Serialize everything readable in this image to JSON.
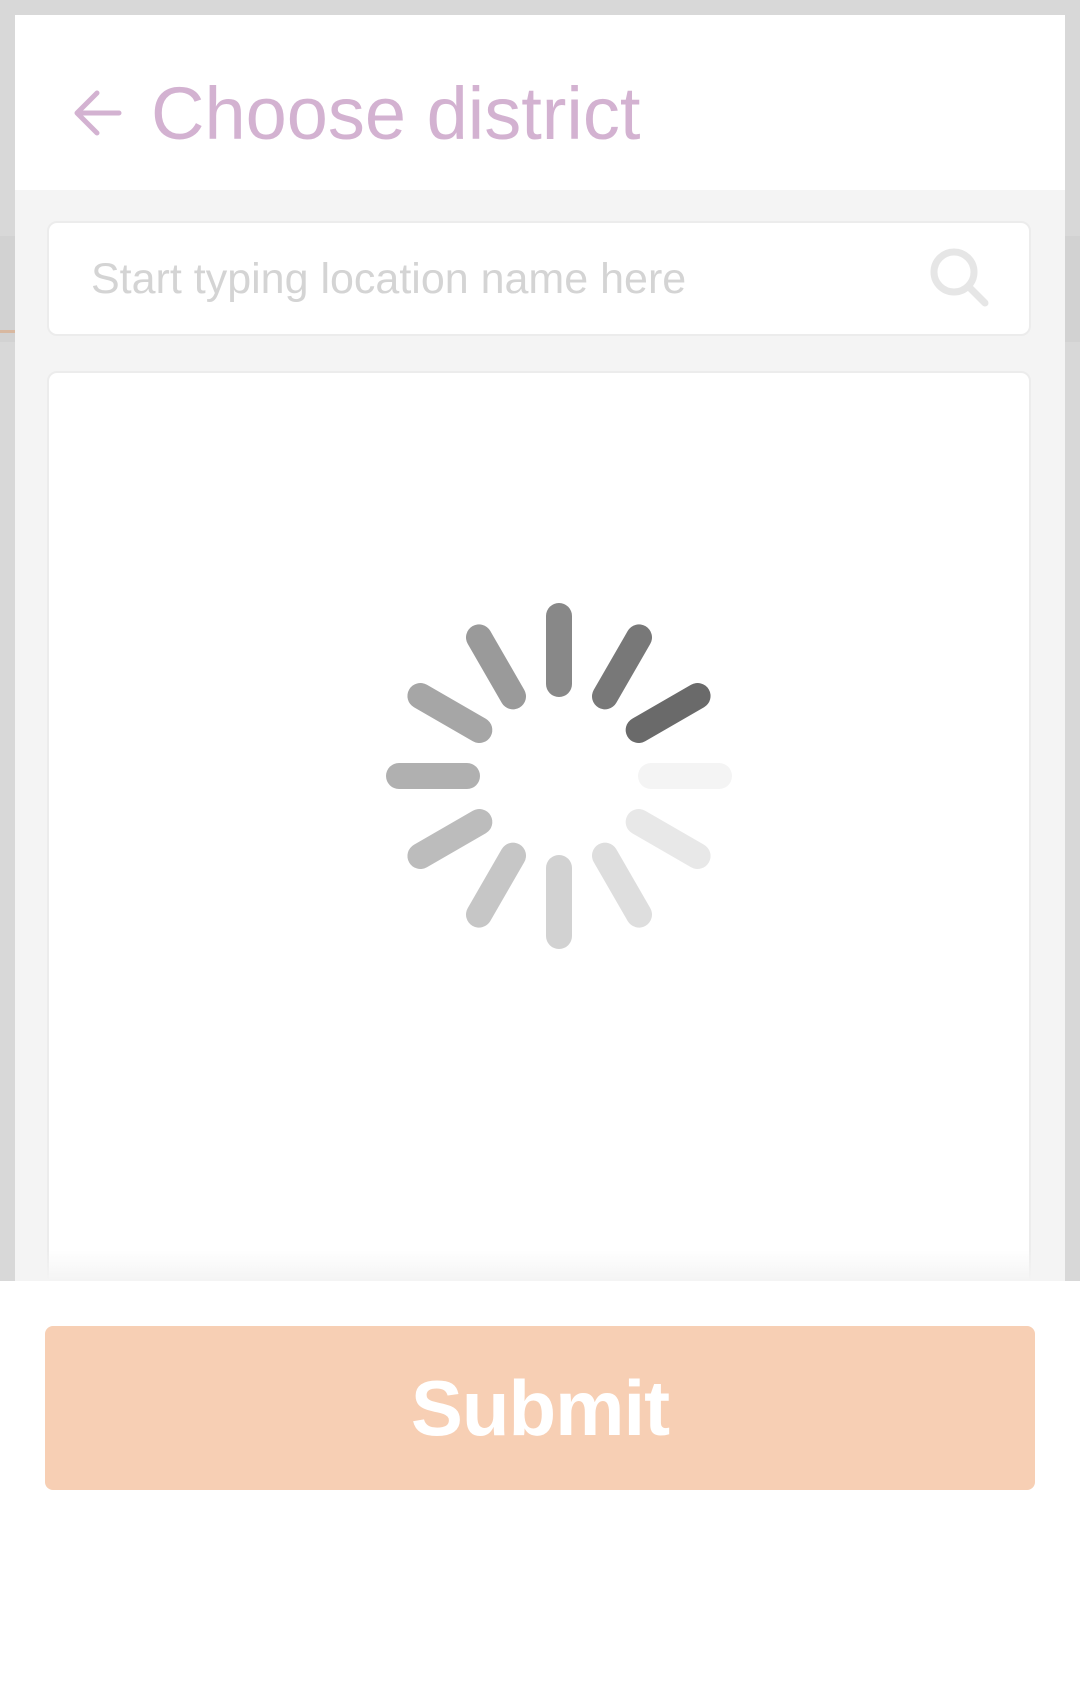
{
  "header": {
    "back_icon": "arrow-left-icon",
    "title": "Choose district"
  },
  "search": {
    "value": "",
    "placeholder": "Start typing location name here",
    "icon": "search-icon"
  },
  "list": {
    "state": "loading",
    "loading_icon": "spinner-icon"
  },
  "footer": {
    "submit_label": "Submit"
  },
  "colors": {
    "title": "#d3b2d1",
    "submit_button": "#f7cfb4",
    "placeholder": "#d4d4d4"
  }
}
